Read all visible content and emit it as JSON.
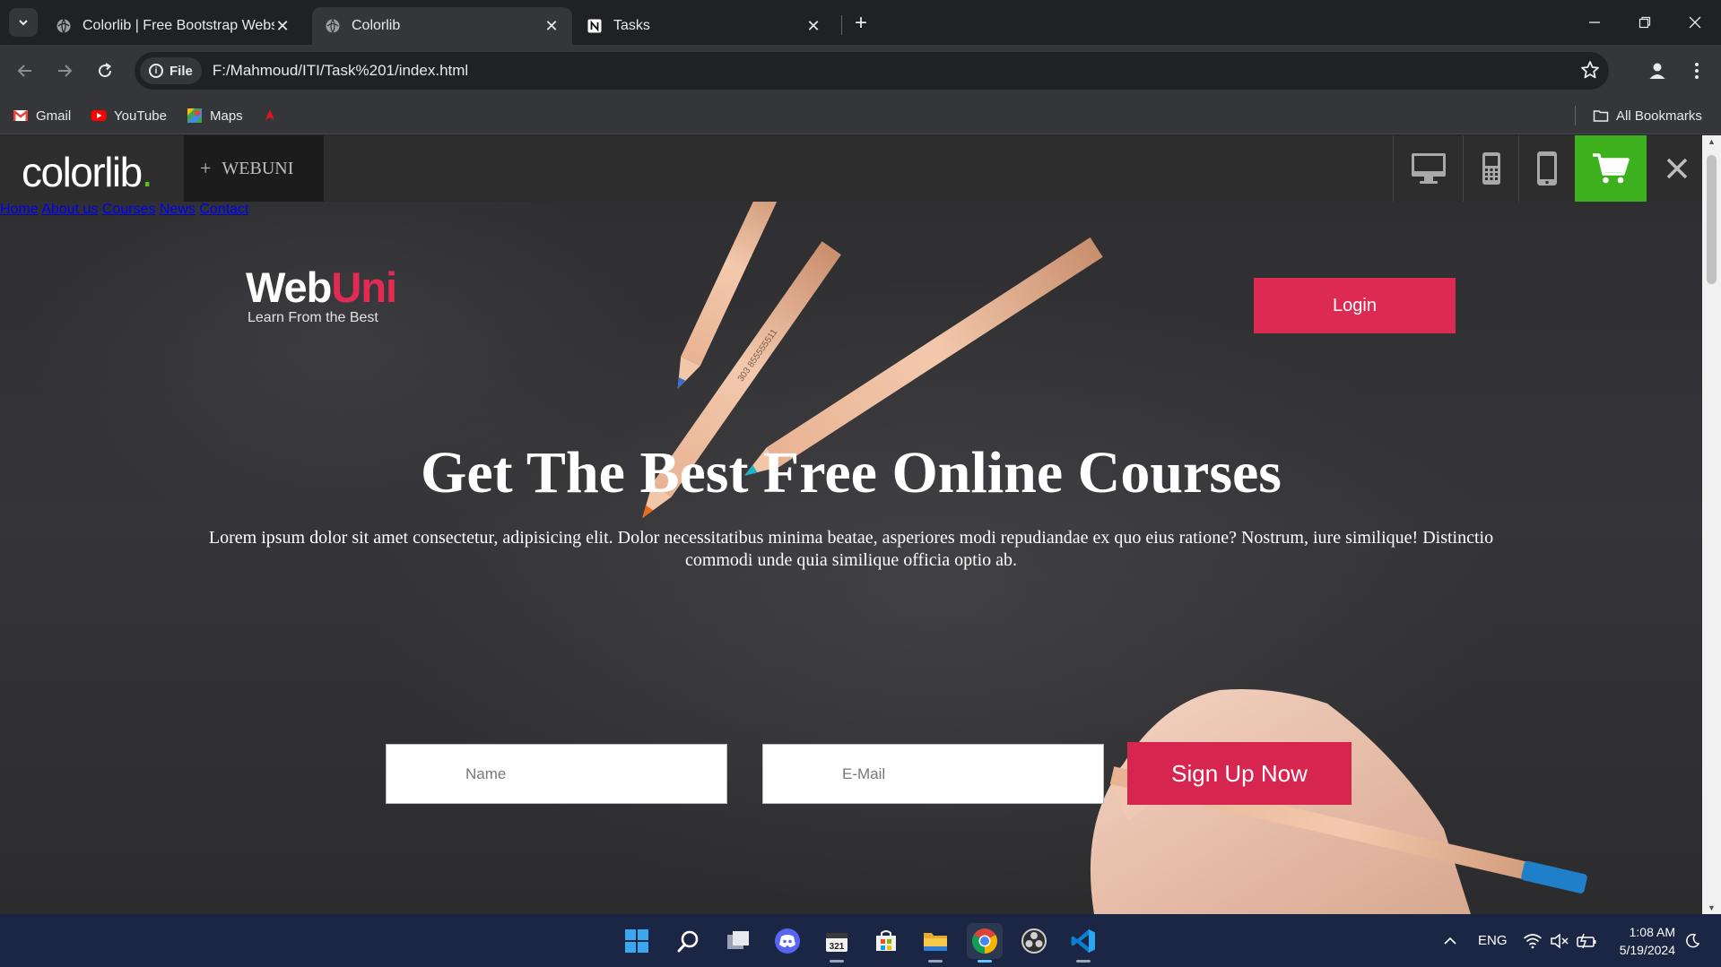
{
  "browser": {
    "tabs": [
      {
        "title": "Colorlib | Free Bootstrap Websi",
        "active": false
      },
      {
        "title": "Colorlib",
        "active": true
      },
      {
        "title": "Tasks",
        "active": false
      }
    ],
    "address": {
      "chip_label": "File",
      "url": "F:/Mahmoud/ITI/Task%201/index.html"
    },
    "bookmarks": [
      {
        "label": "Gmail",
        "icon": "gmail-icon"
      },
      {
        "label": "YouTube",
        "icon": "youtube-icon"
      },
      {
        "label": "Maps",
        "icon": "maps-icon"
      },
      {
        "label": "",
        "icon": "bookmark-red-icon"
      }
    ],
    "all_bookmarks_label": "All Bookmarks"
  },
  "demo_bar": {
    "logo_text": "colorlib",
    "logo_dot": ".",
    "theme_label": "WEBUNI",
    "theme_plus": "+",
    "devices": [
      "desktop-icon",
      "tablet-icon",
      "mobile-icon"
    ],
    "cart_icon": "cart-icon",
    "close_icon": "close-icon",
    "accent_color": "#3cb01d"
  },
  "site": {
    "logo": {
      "web": "Web",
      "uni": "Uni",
      "tagline": "Learn From the Best"
    },
    "nav": [
      "Home",
      "About us",
      "Courses",
      "News",
      "Contact"
    ],
    "login_label": "Login",
    "hero": {
      "title": "Get The Best Free Online Courses",
      "subtitle": "Lorem ipsum dolor sit amet consectetur, adipisicing elit. Dolor necessitatibus minima beatae, asperiores modi repudiandae ex quo eius ratione? Nostrum, iure similique! Distinctio commodi unde quia similique officia optio ab."
    },
    "form": {
      "name_placeholder": "Name",
      "email_placeholder": "E-Mail",
      "signup_label": "Sign Up Now"
    },
    "accent_color": "#dd2a53"
  },
  "taskbar": {
    "apps": [
      "windows-start-icon",
      "search-icon",
      "task-view-icon",
      "discord-icon",
      "calendar-app-icon",
      "microsoft-store-icon",
      "file-explorer-icon",
      "chrome-icon",
      "obs-icon",
      "vscode-icon"
    ],
    "language": "ENG",
    "time": "1:08 AM",
    "date": "5/19/2024"
  }
}
